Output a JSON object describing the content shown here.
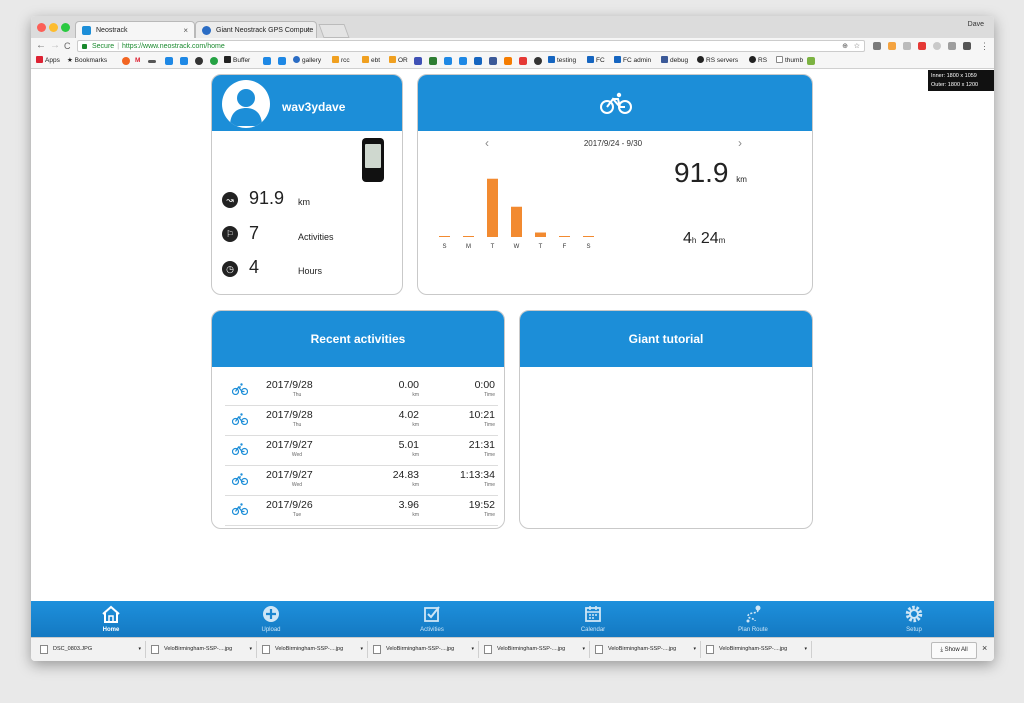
{
  "browser": {
    "user": "Dave",
    "tabs": [
      {
        "label": "Neostrack",
        "close": "×",
        "active": true
      },
      {
        "label": "Giant Neostrack GPS Compute",
        "close": "×",
        "active": false
      }
    ],
    "nav": {
      "back": "←",
      "forward": "→",
      "reload": "C"
    },
    "address": {
      "secure_label": "Secure",
      "separator": "|",
      "url": "https://www.neostrack.com/home"
    },
    "bookmarks": [
      {
        "label": "Apps"
      },
      {
        "label": "Bookmarks"
      },
      {
        "label": "Buffer"
      },
      {
        "label": "gallery"
      },
      {
        "label": "rcc"
      },
      {
        "label": "ebt"
      },
      {
        "label": "OR"
      },
      {
        "label": "testing"
      },
      {
        "label": "FC"
      },
      {
        "label": "FC admin"
      },
      {
        "label": "debug"
      },
      {
        "label": "RS servers"
      },
      {
        "label": "RS"
      },
      {
        "label": "thumb"
      }
    ],
    "bookmark_mail": "M",
    "viewport_badge": {
      "inner": "Inner: 1800 x 1059",
      "outer": "Outer: 1800 x 1200"
    }
  },
  "profile": {
    "username": "wav3ydave",
    "stats": [
      {
        "value": "91.9",
        "unit": "km",
        "icon": "distance-icon"
      },
      {
        "value": "7",
        "unit": "Activities",
        "icon": "activities-icon"
      },
      {
        "value": "4",
        "unit": "Hours",
        "icon": "clock-icon"
      }
    ]
  },
  "weekly": {
    "prev": "‹",
    "next": "›",
    "date_range": "2017/9/24 - 9/30",
    "distance": "91.9",
    "distance_unit": "km",
    "hours": "4",
    "hours_unit": "h",
    "minutes": "24",
    "minutes_unit": "m"
  },
  "chart_data": {
    "type": "bar",
    "categories": [
      "S",
      "M",
      "T",
      "W",
      "T",
      "F",
      "S"
    ],
    "values": [
      0,
      0,
      52,
      27,
      4,
      0,
      0
    ],
    "ylim": [
      0,
      58
    ],
    "color": "#f28a30"
  },
  "recent": {
    "title": "Recent activities",
    "rows": [
      {
        "date": "2017/9/28",
        "day": "Thu",
        "distance": "0.00",
        "dist_unit": "km",
        "time": "0:00",
        "time_label": "Time"
      },
      {
        "date": "2017/9/28",
        "day": "Thu",
        "distance": "4.02",
        "dist_unit": "km",
        "time": "10:21",
        "time_label": "Time"
      },
      {
        "date": "2017/9/27",
        "day": "Wed",
        "distance": "5.01",
        "dist_unit": "km",
        "time": "21:31",
        "time_label": "Time"
      },
      {
        "date": "2017/9/27",
        "day": "Wed",
        "distance": "24.83",
        "dist_unit": "km",
        "time": "1:13:34",
        "time_label": "Time"
      },
      {
        "date": "2017/9/26",
        "day": "Tue",
        "distance": "3.96",
        "dist_unit": "km",
        "time": "19:52",
        "time_label": "Time"
      }
    ]
  },
  "tutorial": {
    "title": "Giant tutorial"
  },
  "bottom_nav": [
    {
      "label": "Home",
      "icon": "home-icon",
      "active": true
    },
    {
      "label": "Upload",
      "icon": "upload-icon",
      "active": false
    },
    {
      "label": "Activities",
      "icon": "activities-check-icon",
      "active": false
    },
    {
      "label": "Calendar",
      "icon": "calendar-icon",
      "active": false
    },
    {
      "label": "Plan Route",
      "icon": "route-icon",
      "active": false
    },
    {
      "label": "Setup",
      "icon": "gear-icon",
      "active": false
    }
  ],
  "downloads": {
    "items": [
      {
        "name": "DSC_0803.JPG"
      },
      {
        "name": "VeloBirmingham-SSP-....jpg"
      },
      {
        "name": "VeloBirmingham-SSP-....jpg"
      },
      {
        "name": "VeloBirmingham-SSP-....jpg"
      },
      {
        "name": "VeloBirmingham-SSP-....jpg"
      },
      {
        "name": "VeloBirmingham-SSP-....jpg"
      },
      {
        "name": "VeloBirmingham-SSP-....jpg"
      }
    ],
    "arrow": "▾",
    "show_all": "Show All",
    "close": "×"
  },
  "colors": {
    "brand": "#1c8ed8",
    "bar": "#f28a30",
    "nav": "#1479c2"
  }
}
